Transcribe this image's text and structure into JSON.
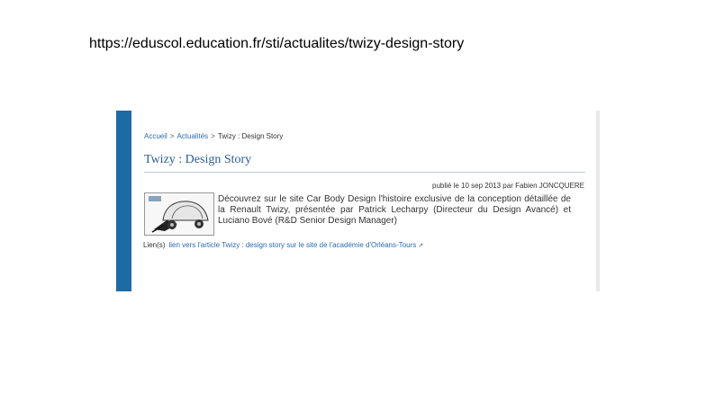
{
  "url_caption": "https://eduscol.education.fr/sti/actualites/twizy-design-story",
  "breadcrumb": {
    "items": [
      "Accueil",
      "Actualités",
      "Twizy : Design Story"
    ],
    "separator": ">"
  },
  "article": {
    "title": "Twizy : Design Story",
    "published": "publié le 10 sep 2013 par Fabien JONCQUERE",
    "description": "Découvrez sur le site Car Body Design l'histoire exclusive de la conception détaillée de la Renault Twizy, présentée par Patrick Lecharpy (Directeur du Design Avancé) et Luciano Bové (R&D Senior Design Manager)",
    "thumbnail_icon": "twizy-car-sketch-icon"
  },
  "links": {
    "label": "Lien(s)",
    "link_text": "lien vers l'article Twizy : design story sur le site de l'académie d'Orléans-Tours",
    "external_icon": "external-link-icon"
  },
  "colors": {
    "sidebar_blue": "#1e6aa5",
    "link_blue": "#2a6bb0",
    "title_blue": "#2b5d92"
  }
}
